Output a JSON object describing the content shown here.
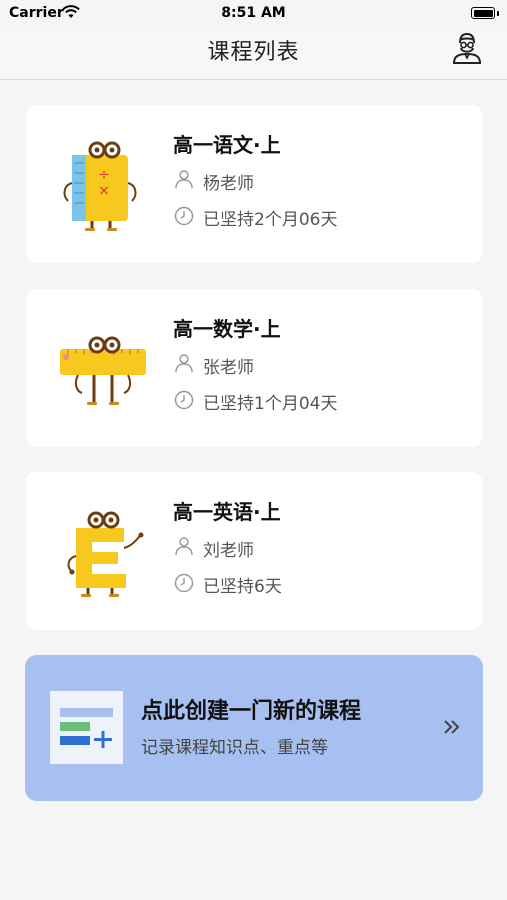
{
  "status_bar": {
    "carrier": "Carrier",
    "time": "8:51 AM"
  },
  "navbar": {
    "title": "课程列表",
    "profile_icon": "user-avatar-icon"
  },
  "courses": [
    {
      "title": "高一语文·上",
      "teacher": "杨老师",
      "duration": "已坚持2个月06天",
      "mascot": "book-mascot"
    },
    {
      "title": "高一数学·上",
      "teacher": "张老师",
      "duration": "已坚持1个月04天",
      "mascot": "ruler-mascot"
    },
    {
      "title": "高一英语·上",
      "teacher": "刘老师",
      "duration": "已坚持6天",
      "mascot": "letter-e-mascot"
    }
  ],
  "create": {
    "title": "点此创建一门新的课程",
    "subtitle": "记录课程知识点、重点等",
    "arrow_icon": "double-chevron-right-icon"
  },
  "colors": {
    "card_bg": "#ffffff",
    "banner_bg": "#a7bff1",
    "mascot_yellow": "#f7c81d",
    "icon_blue": "#2f6fd1"
  }
}
